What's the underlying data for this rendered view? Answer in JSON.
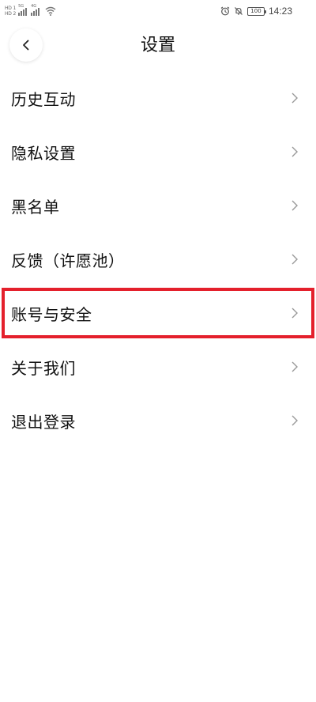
{
  "status_bar": {
    "hd1": "HD 1",
    "hd2": "HD 2",
    "net1": "5G",
    "net2": "4G",
    "battery": "100",
    "time": "14:23"
  },
  "header": {
    "title": "设置"
  },
  "menu": {
    "items": [
      {
        "label": "历史互动"
      },
      {
        "label": "隐私设置"
      },
      {
        "label": "黑名单"
      },
      {
        "label": "反馈（许愿池）"
      },
      {
        "label": "账号与安全"
      },
      {
        "label": "关于我们"
      },
      {
        "label": "退出登录"
      }
    ]
  },
  "colors": {
    "highlight_border": "#e4202c",
    "text": "#111111",
    "chevron": "#999999"
  }
}
